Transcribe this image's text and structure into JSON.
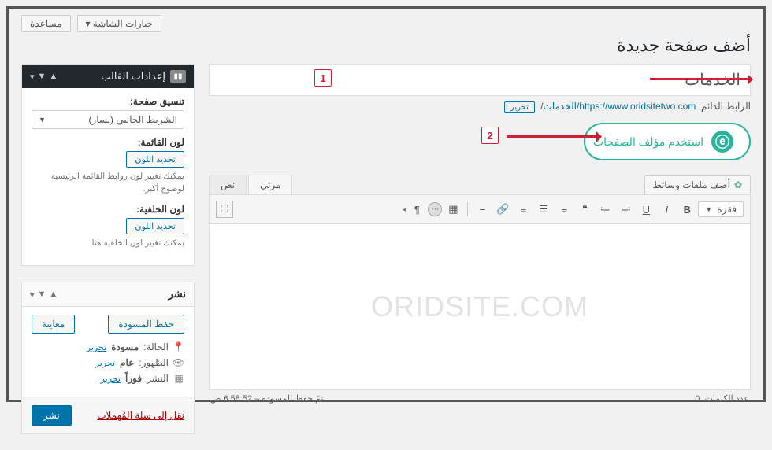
{
  "topbar": {
    "screen_options": "خيارات الشاشة",
    "help": "مساعدة"
  },
  "page_heading": "أضف صفحة جديدة",
  "title_input": {
    "value": "الخدمات"
  },
  "annotations": {
    "one": "1",
    "two": "2"
  },
  "permalink": {
    "label": "الرابط الدائم:",
    "base_url": "https://www.oridsitetwo.com",
    "slug": "الخدمات",
    "edit": "تحرير"
  },
  "composer_button": "استخدم مؤلف الصفحات",
  "editor": {
    "add_media": "أضف ملفات وسائط",
    "tab_visual": "مرئي",
    "tab_text": "نص",
    "paragraph_selector": "فقرة",
    "tb": {
      "bold": "B",
      "italic": "I",
      "underline": "U",
      "ul": "≡",
      "ol": "≣",
      "quote": "❝",
      "align_l": "≡",
      "align_c": "≡",
      "align_r": "≡",
      "link": "🔗",
      "more": "—",
      "para": "¶"
    },
    "watermark": "ORIDSITE.COM"
  },
  "footer": {
    "word_count_label": "عدد الكلمات:",
    "word_count": "0",
    "save_label": "تمّ حفظ المسودة – ",
    "save_time": "6:58:52 ص"
  },
  "theme_panel": {
    "title": "إعدادات القالب",
    "format_label": "تنسيق صفحة:",
    "format_value": "الشريط الجانبي (يسار)",
    "menu_color_label": "لون القائمة:",
    "menu_color_help": "يمكنك تغيير لون روابط القائمة الرئيسية لوضوح أكبر.",
    "bg_color_label": "لون الخلفية:",
    "bg_color_help": "يمكنك تغيير لون الخلفية هنا.",
    "set_color": "تحديد اللون"
  },
  "publish_panel": {
    "title": "نشر",
    "save_draft": "حفظ المسودة",
    "preview": "معاينة",
    "status_label": "الحالة:",
    "status_value": "مسودة",
    "vis_label": "الظهور:",
    "vis_value": "عام",
    "sched_label": "النشر",
    "sched_value": "فوراً",
    "edit": "تحرير",
    "trash": "نقل إلى سلة المُهملات",
    "publish": "نشر"
  }
}
